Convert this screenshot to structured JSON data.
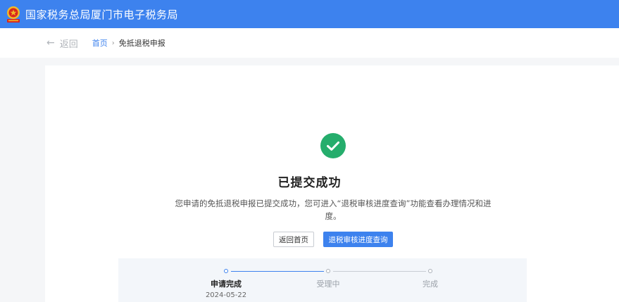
{
  "header": {
    "title": "国家税务总局厦门市电子税务局",
    "colors": {
      "brand": "#3d82ee",
      "emblem_red": "#d9261c",
      "emblem_gold": "#f1b928"
    }
  },
  "breadcrumb": {
    "back_label": "返回",
    "home_label": "首页",
    "current_label": "免抵退税申报"
  },
  "result": {
    "title": "已提交成功",
    "description": "您申请的免抵退税申报已提交成功，您可进入“退税审核进度查询”功能查看办理情况和进度。",
    "icon": "check-circle-icon",
    "color": "#25ad6c"
  },
  "actions": {
    "home_button": "返回首页",
    "query_button": "退税审核进度查询"
  },
  "steps": [
    {
      "label": "申请完成",
      "date": "2024-05-22",
      "status": "done"
    },
    {
      "label": "受理中",
      "date": "",
      "status": "pending"
    },
    {
      "label": "完成",
      "date": "",
      "status": "pending"
    }
  ]
}
